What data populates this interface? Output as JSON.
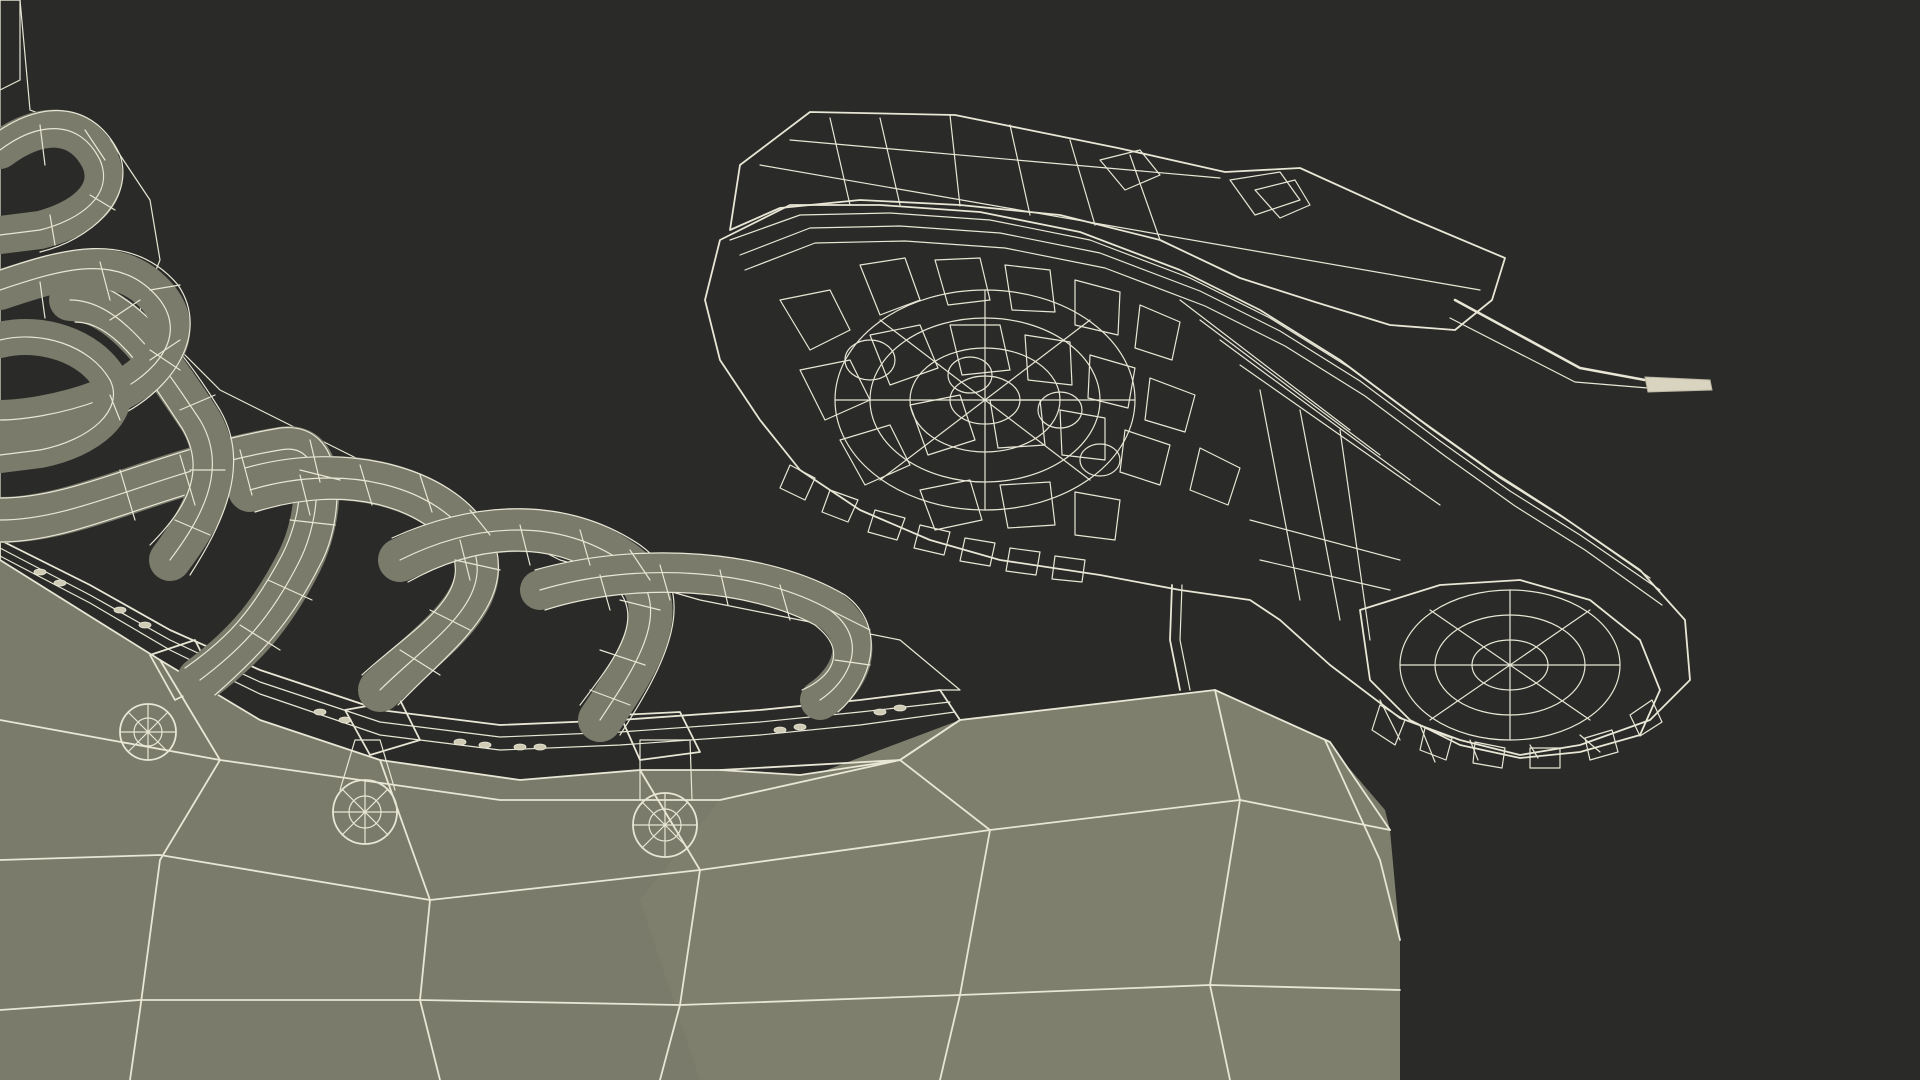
{
  "viewport": {
    "background": "#2a2a29",
    "mesh_fill": "#7a7b6b",
    "mesh_fill_dark": "#6f7062",
    "mesh_fill_light": "#858673",
    "wire_color": "#e8e6d4"
  },
  "scene": {
    "objects": [
      {
        "kind": "boot-upper-closeup",
        "features": [
          "laces",
          "lace-hooks",
          "eyelets"
        ]
      },
      {
        "kind": "boot-sole-underside",
        "features": [
          "lugged-tread",
          "heel",
          "lace-tip"
        ]
      }
    ]
  }
}
